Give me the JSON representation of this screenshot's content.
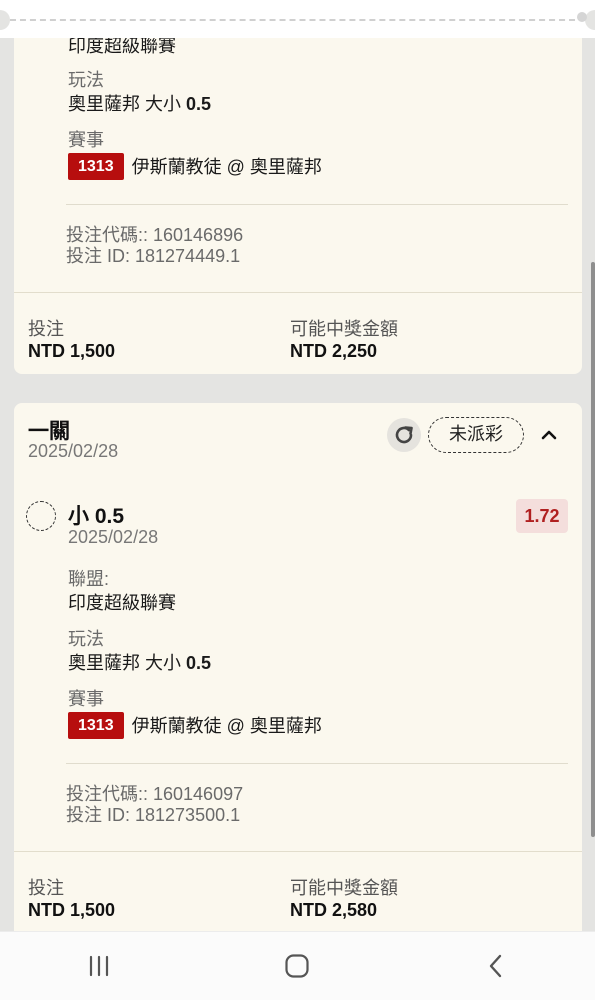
{
  "bets": [
    {
      "league_value": "印度超級聯賽",
      "market_label": "玩法",
      "market_value_prefix": "奧里薩邦 大小 ",
      "market_value_bold": "0.5",
      "event_label": "賽事",
      "event_badge": "1313",
      "event_name": "伊斯蘭教徒 @ 奧里薩邦",
      "bet_code": "投注代碼:: 160146896",
      "bet_id": "投注 ID: 181274449.1",
      "stake_label": "投注",
      "stake_value": "NTD 1,500",
      "payout_label": "可能中獎金額",
      "payout_value": "NTD 2,250"
    },
    {
      "title": "一關",
      "date": "2025/02/28",
      "status": "未派彩",
      "selection": "小 0.5",
      "selection_date": "2025/02/28",
      "odds": "1.72",
      "league_label": "聯盟:",
      "league_value": "印度超級聯賽",
      "market_label": "玩法",
      "market_value_prefix": "奧里薩邦 大小 ",
      "market_value_bold": "0.5",
      "event_label": "賽事",
      "event_badge": "1313",
      "event_name": "伊斯蘭教徒 @ 奧里薩邦",
      "bet_code": "投注代碼:: 160146097",
      "bet_id": "投注 ID: 181273500.1",
      "stake_label": "投注",
      "stake_value": "NTD 1,500",
      "payout_label": "可能中獎金額",
      "payout_value": "NTD 2,580"
    }
  ],
  "icons": {
    "refresh": "refresh-icon",
    "collapse": "chevron-up-icon",
    "nav_recent": "recent-apps-icon",
    "nav_home": "home-icon",
    "nav_back": "back-icon"
  },
  "colors": {
    "card_bg": "#fbf8ee",
    "badge_red": "#b70e0e",
    "odds_bg": "#f4dedc",
    "odds_text": "#b02020"
  }
}
